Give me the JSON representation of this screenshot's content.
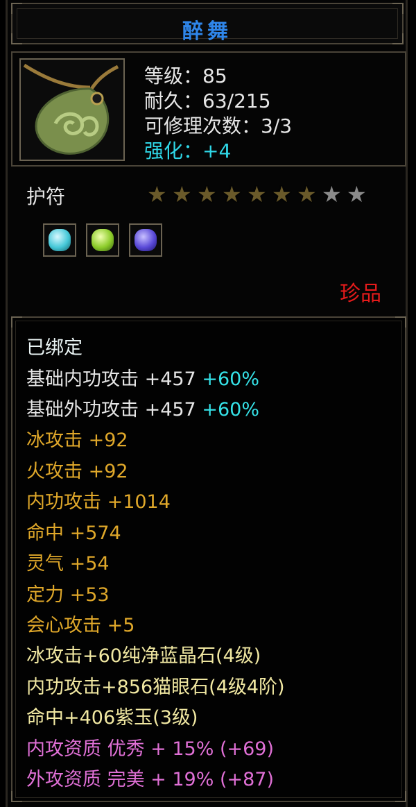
{
  "item": {
    "name": "醉舞",
    "level": "等级：85",
    "durability": "耐久：63/215",
    "repair": "可修理次数：3/3",
    "enhance": "强化：+4",
    "type": "护符",
    "rarity": "珍品",
    "stars_total": 9,
    "stars_lit": 7
  },
  "gems": [
    {
      "icon": "cyan-crystal-icon",
      "color": "#46c8d8"
    },
    {
      "icon": "green-crystal-icon",
      "color": "#8ccc2a"
    },
    {
      "icon": "purple-crystal-icon",
      "color": "#5a4ad8"
    }
  ],
  "stats": {
    "bound": "已绑定",
    "base_inner_label": "基础内功攻击 +457",
    "base_inner_bonus": "+60%",
    "base_outer_label": "基础外功攻击 +457",
    "base_outer_bonus": "+60%",
    "ice": "冰攻击 +92",
    "fire": "火攻击 +92",
    "inner": "内功攻击 +1014",
    "hit": "命中 +574",
    "spirit": "灵气 +54",
    "focus": "定力 +53",
    "crit": "会心攻击 +5",
    "gem1": "冰攻击+60纯净蓝晶石(4级)",
    "gem2": "内功攻击+856猫眼石(4级4阶)",
    "gem3": "命中+406紫玉(3级)",
    "quality_inner": "内攻资质 优秀 + 15% (+69)",
    "quality_outer": "外攻资质 完美 + 19% (+87)"
  },
  "colors": {
    "title": "#2f86ea",
    "enhance": "#2fd8e8",
    "rarity": "#e51b1b",
    "attr_gold": "#e0a82a",
    "gem_line": "#f1e8a2",
    "quality": "#e070d6",
    "bonus": "#35e2e8"
  }
}
